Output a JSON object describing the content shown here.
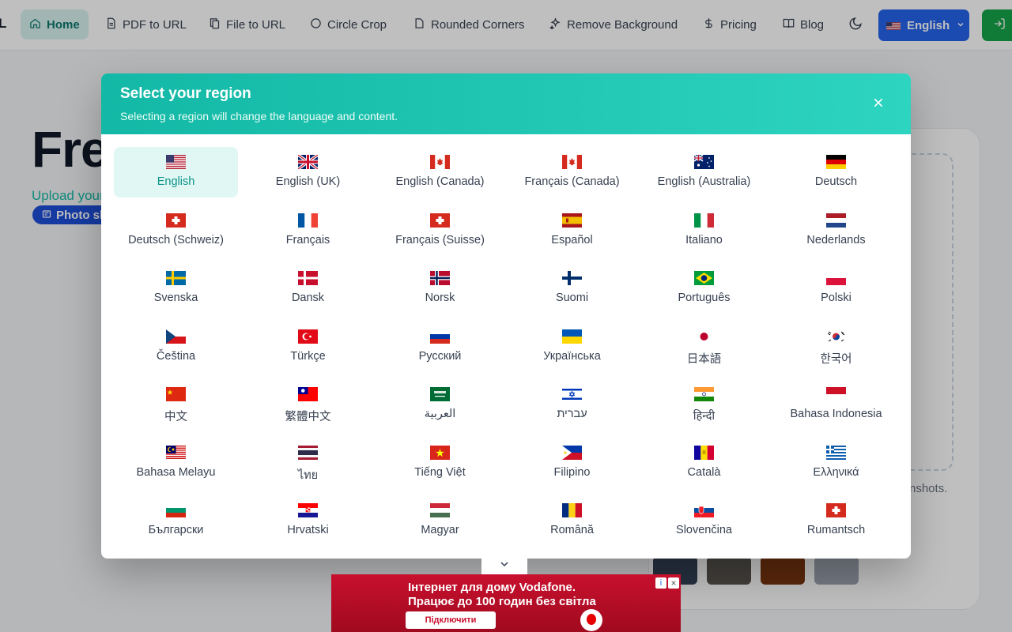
{
  "nav": {
    "brand": "L",
    "items": [
      {
        "label": "Home",
        "icon": "home-icon",
        "active": true
      },
      {
        "label": "PDF to URL",
        "icon": "document-icon"
      },
      {
        "label": "File to URL",
        "icon": "files-icon"
      },
      {
        "label": "Circle Crop",
        "icon": "circle-icon"
      },
      {
        "label": "Rounded Corners",
        "icon": "rounded-square-icon"
      },
      {
        "label": "Remove Background",
        "icon": "sparkles-icon"
      },
      {
        "label": "Pricing",
        "icon": "dollar-icon"
      },
      {
        "label": "Blog",
        "icon": "book-icon"
      }
    ],
    "language_button": "English",
    "theme_icon": "moon-icon",
    "login_icon": "login-icon"
  },
  "background": {
    "hero_title": "Fre",
    "hero_subtitle": "Upload your",
    "badge": "Photo sh",
    "upload_note": "nshots."
  },
  "modal": {
    "title": "Select your region",
    "subtitle": "Selecting a region will change the language and content.",
    "close_icon": "close-icon",
    "regions": [
      {
        "label": "English",
        "flag": "us",
        "selected": true
      },
      {
        "label": "English (UK)",
        "flag": "uk"
      },
      {
        "label": "English (Canada)",
        "flag": "ca"
      },
      {
        "label": "Français (Canada)",
        "flag": "ca"
      },
      {
        "label": "English (Australia)",
        "flag": "au"
      },
      {
        "label": "Deutsch",
        "flag": "de"
      },
      {
        "label": "Deutsch (Schweiz)",
        "flag": "ch"
      },
      {
        "label": "Français",
        "flag": "fr"
      },
      {
        "label": "Français (Suisse)",
        "flag": "ch"
      },
      {
        "label": "Español",
        "flag": "es"
      },
      {
        "label": "Italiano",
        "flag": "it"
      },
      {
        "label": "Nederlands",
        "flag": "nl"
      },
      {
        "label": "Svenska",
        "flag": "se"
      },
      {
        "label": "Dansk",
        "flag": "dk"
      },
      {
        "label": "Norsk",
        "flag": "no"
      },
      {
        "label": "Suomi",
        "flag": "fi"
      },
      {
        "label": "Português",
        "flag": "br"
      },
      {
        "label": "Polski",
        "flag": "pl"
      },
      {
        "label": "Čeština",
        "flag": "cz"
      },
      {
        "label": "Türkçe",
        "flag": "tr"
      },
      {
        "label": "Русский",
        "flag": "ru"
      },
      {
        "label": "Українська",
        "flag": "ua"
      },
      {
        "label": "日本語",
        "flag": "jp"
      },
      {
        "label": "한국어",
        "flag": "kr"
      },
      {
        "label": "中文",
        "flag": "cn"
      },
      {
        "label": "繁體中文",
        "flag": "tw"
      },
      {
        "label": "العربية",
        "flag": "sa"
      },
      {
        "label": "עברית",
        "flag": "il"
      },
      {
        "label": "हिन्दी",
        "flag": "in"
      },
      {
        "label": "Bahasa Indonesia",
        "flag": "id"
      },
      {
        "label": "Bahasa Melayu",
        "flag": "my"
      },
      {
        "label": "ไทย",
        "flag": "th"
      },
      {
        "label": "Tiếng Việt",
        "flag": "vn"
      },
      {
        "label": "Filipino",
        "flag": "ph"
      },
      {
        "label": "Català",
        "flag": "ad"
      },
      {
        "label": "Ελληνικά",
        "flag": "gr"
      },
      {
        "label": "Български",
        "flag": "bg"
      },
      {
        "label": "Hrvatski",
        "flag": "hr"
      },
      {
        "label": "Magyar",
        "flag": "hu"
      },
      {
        "label": "Română",
        "flag": "ro"
      },
      {
        "label": "Slovenčina",
        "flag": "sk"
      },
      {
        "label": "Rumantsch",
        "flag": "ch"
      }
    ]
  },
  "ad": {
    "line1": "Інтернет для дому Vodafone.",
    "line2": "Працює до 100 годин без світла",
    "cta": "Підключити",
    "info_icon": "info-icon",
    "close_icon": "close-icon",
    "collapse_icon": "chevron-down-icon"
  },
  "colors": {
    "accent": "#14b8a6",
    "language_button": "#2563eb",
    "login_button": "#16a34a",
    "ad_background": "#c8102e"
  }
}
